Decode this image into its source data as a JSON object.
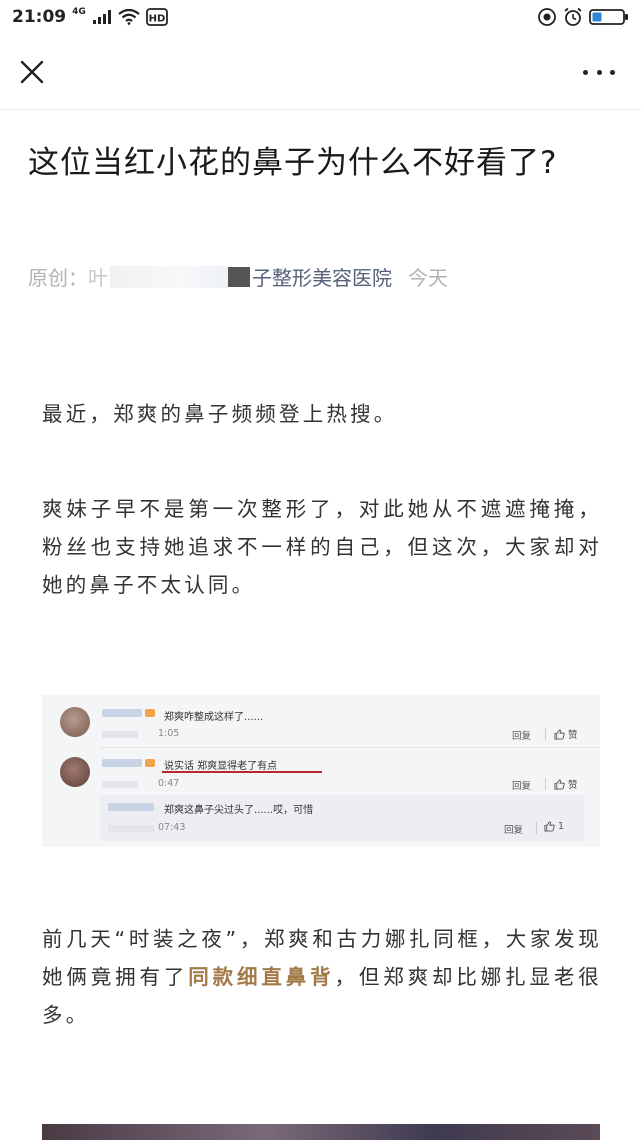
{
  "status_bar": {
    "time": "21:09",
    "network": "4G",
    "hd_label": "HD",
    "icons": [
      "signal-icon",
      "wifi-icon",
      "hd-icon",
      "sync-icon",
      "alarm-icon",
      "battery-icon"
    ]
  },
  "nav": {
    "close_icon": "close-icon",
    "more_icon": "more-icon"
  },
  "article": {
    "title": "这位当红小花的鼻子为什么不好看了?",
    "meta_prefix": "原创：",
    "meta_partial": "叶",
    "meta_account_suffix": "子整形美容医院",
    "meta_date": "今天",
    "p1": "最近，郑爽的鼻子频频登上热搜。",
    "p2": "爽妹子早不是第一次整形了，对此她从不遮遮掩掩，粉丝也支持她追求不一样的自己，但这次，大家却对她的鼻子不太认同。",
    "p3_before": "前几天“时装之夜”，郑爽和古力娜扎同框，大家发现她俩竟拥有了",
    "p3_highlight": "同款细直鼻背",
    "p3_after": "，但郑爽却比娜扎显老很多。"
  },
  "comments": {
    "c1_text": "郑爽咋整成这样了......",
    "c1_time": "1:05",
    "c2_text": "说实话 郑爽显得老了有点",
    "c2_time": "0:47",
    "c3_text": "郑爽这鼻子尖过头了......哎，可惜",
    "c3_time": "07:43",
    "reply_label": "回复",
    "like_label": "赞",
    "like_count": "1"
  },
  "colors": {
    "highlight": "#a37b4a",
    "underline": "#c0242b",
    "meta_gray": "#b3b3b3"
  }
}
